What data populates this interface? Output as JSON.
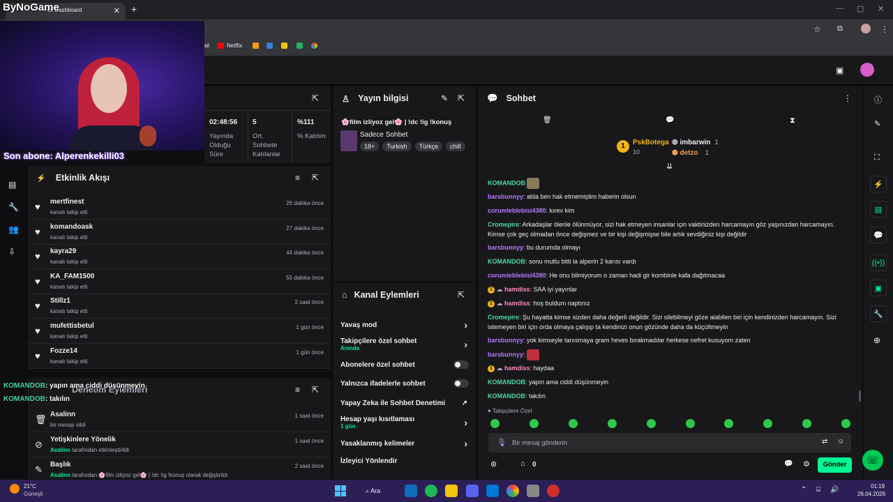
{
  "browser": {
    "tab_title": "ck Dashboard",
    "bookmarks": [
      "ail",
      "Netflix"
    ]
  },
  "overlay": {
    "logo": "ByNoGame",
    "last_sub": "Son abone: Alperenkekilli03",
    "chat_lines": [
      {
        "user": "KOMANDOB",
        "text": ": yapın ama ciddi düşünmeyin"
      },
      {
        "user": "KOMANDOB",
        "text": ": takılın"
      }
    ]
  },
  "stats": [
    {
      "value": "02:48:56",
      "label": "Yayında Olduğu Süre"
    },
    {
      "value": "5",
      "label": "Ort. Sohbete Katılanlar"
    },
    {
      "value": "%111",
      "label": "% Katılım"
    }
  ],
  "stream_info": {
    "title": "Yayın bilgisi",
    "stream_title": "🌸film izliyoz gel🌸 | !dc !ig !konuş",
    "category": "Sadece Sohbet",
    "tags": [
      "18+",
      "Turkish",
      "Türkçe",
      "chill"
    ]
  },
  "activity": {
    "title": "Etkinlik Akışı",
    "items": [
      {
        "name": "mertfinest",
        "sub": "kanalı takip etti",
        "time": "26 dakika önce"
      },
      {
        "name": "komandoask",
        "sub": "kanalı takip etti",
        "time": "27 dakika önce"
      },
      {
        "name": "kayra29",
        "sub": "kanalı takip etti",
        "time": "44 dakika önce"
      },
      {
        "name": "KA_FAM1500",
        "sub": "kanalı takip etti",
        "time": "55 dakika önce"
      },
      {
        "name": "Stillz1",
        "sub": "kanalı takip etti",
        "time": "2 saat önce"
      },
      {
        "name": "mufettisbetul",
        "sub": "kanalı takip etti",
        "time": "1 gün önce"
      },
      {
        "name": "Fozze14",
        "sub": "kanalı takip etti",
        "time": "1 gün önce"
      }
    ]
  },
  "mod_actions": {
    "title": "Denetim Eylemleri",
    "items": [
      {
        "name": "Asalinn",
        "sub_user": "",
        "sub": "bir mesajı sildi",
        "time": "1 saat önce"
      },
      {
        "name": "Yetişkinlere Yönelik",
        "sub_user": "Asalinn",
        "sub": " tarafından etkinleştirildi",
        "time": "1 saat önce"
      },
      {
        "name": "Başlık",
        "sub_user": "Asalinn",
        "sub": " tarafından 🌸film izliyoz gel🌸 | !dc !ig !konuş olarak değiştirildi",
        "time": "2 saat önce"
      }
    ]
  },
  "channel_actions": {
    "title": "Kanal Eylemleri",
    "items": [
      {
        "label": "Yavaş mod",
        "sub": "",
        "control": "arrow"
      },
      {
        "label": "Takipçilere özel sohbet",
        "sub": "Anında",
        "control": "arrow"
      },
      {
        "label": "Abonelere özel sohbet",
        "sub": "",
        "control": "toggle"
      },
      {
        "label": "Yalnızca ifadelerle sohbet",
        "sub": "",
        "control": "toggle"
      },
      {
        "label": "Yapay Zeka ile Sohbet Denetimi",
        "sub": "",
        "control": "external"
      },
      {
        "label": "Hesap yaşı kısıtlaması",
        "sub": "1 gün",
        "control": "arrow"
      },
      {
        "label": "Yasaklanmış kelimeler",
        "sub": "",
        "control": "arrow"
      },
      {
        "label": "İzleyici Yönlendir",
        "sub": "",
        "control": "none"
      }
    ]
  },
  "chat": {
    "title": "Sohbet",
    "leaderboard": [
      {
        "rank": "1",
        "name": "PskBotega",
        "count": "10"
      },
      {
        "name": "imbarwin",
        "count": "1"
      },
      {
        "name": "detzo",
        "count": "1"
      }
    ],
    "messages": [
      {
        "user": "KOMANDOB",
        "color": "#4cd9a6",
        "text": "",
        "emote": "#8a7a5a"
      },
      {
        "user": "barsbunnyy",
        "color": "#b57bff",
        "text": ": abla ben hak etmemiştim haberin olsun"
      },
      {
        "user": "corumleblebisi4380",
        "color": "#b57bff",
        "text": ": kırev kim"
      },
      {
        "user": "Cromepire",
        "color": "#4cd9a6",
        "text": ": Arkadaşlar ölenle ölünmüyor, sizi hak etmeyen insanlar için vaktinizden harcamayın göz yaşınızdan harcamayın. Kimse çok geç olmadan önce değişmez ve bir kişi değişmişse bile artık sevdiğiniz kişi değildir"
      },
      {
        "user": "barsbunnyy",
        "color": "#b57bff",
        "text": ": bu durumda olmayı"
      },
      {
        "user": "KOMANDOB",
        "color": "#4cd9a6",
        "text": ": sonu mutlu bitti la alperin 2 karısı vardı"
      },
      {
        "user": "corumleblebisi4380",
        "color": "#b57bff",
        "text": ": He onu bilmiyorum o zaman hadi gir kombinle kafa dağıtmacaa"
      },
      {
        "user": "hamdiss",
        "color": "#ff8fbf",
        "text": ": SAA iyi yayınlar",
        "badges": true
      },
      {
        "user": "hamdiss",
        "color": "#ff8fbf",
        "text": ": hoş buldum naptınız",
        "badges": true
      },
      {
        "user": "Cromepire",
        "color": "#4cd9a6",
        "text": ": Şu hayatta kimse sizden daha değerli değildir. Sizi silebilmeyi göze alabilen biri için kendinizden harcamayın. Sizi istemeyen biri için orda olmaya çalışıp ta kendinizi onun gözünde daha da küçültmeyin"
      },
      {
        "user": "barsbunnyy",
        "color": "#b57bff",
        "text": ": yok kimseyle tanısmaya gram heves bırakmadılar herkese nefret kusuyom zaten"
      },
      {
        "user": "barsbunnyy",
        "color": "#b57bff",
        "text": ":",
        "emote": "#c0303a"
      },
      {
        "user": "hamdiss",
        "color": "#ff8fbf",
        "text": ": haydaa",
        "badges": true
      },
      {
        "user": "KOMANDOB",
        "color": "#4cd9a6",
        "text": ": yapın ama ciddi düşünmeyin"
      },
      {
        "user": "KOMANDOB",
        "color": "#4cd9a6",
        "text": ": takılın"
      }
    ],
    "followers_only": "Takipçilere Özel",
    "input_placeholder": "Bir mesaj gönderin",
    "points": "0",
    "send_label": "Gönder"
  },
  "taskbar": {
    "temp": "21°C",
    "weather": "Güneşli",
    "search": "Ara",
    "time": "01:19",
    "date": "26.04.2026"
  },
  "colors": {
    "accent_green": "#00f593",
    "panel_bg": "#18181b",
    "taskbar": "#2b1f56"
  }
}
